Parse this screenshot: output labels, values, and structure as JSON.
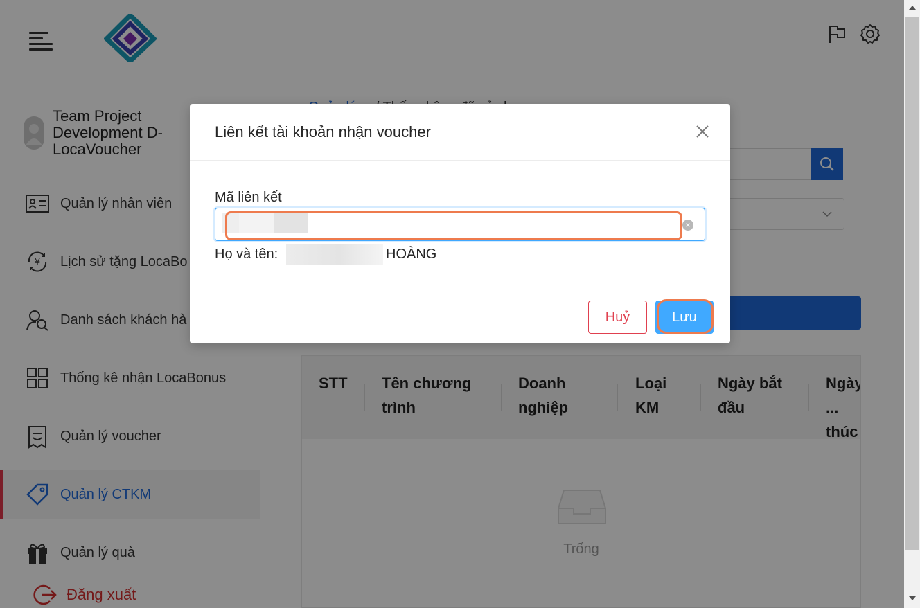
{
  "sidebar": {
    "user_name": "Team Project Development D-LocaVoucher",
    "items": [
      {
        "label": "Quản lý nhân viên",
        "icon": "id-card-icon"
      },
      {
        "label": "Lịch sử tặng LocaBo",
        "icon": "yen-cycle-icon"
      },
      {
        "label": "Danh sách khách hà",
        "icon": "user-search-icon"
      },
      {
        "label": "Thống kê nhận LocaBonus",
        "icon": "grid-icon"
      },
      {
        "label": "Quản lý voucher",
        "icon": "voucher-doc-icon"
      },
      {
        "label": "Quản lý CTKM",
        "icon": "tag-icon"
      },
      {
        "label": "Quản lý quà",
        "icon": "gift-icon"
      }
    ],
    "active_item": "Quản lý CTKM",
    "logout_label": "Đăng xuất"
  },
  "content": {
    "breadcrumb_link": "Quản lý ...",
    "breadcrumb_current": "Thống kê ... đã sử dụng",
    "table_headers": [
      "STT",
      "Tên chương trình",
      "Doanh nghiệp",
      "Loại KM",
      "Ngày bắt đầu",
      "Ngày ... thúc"
    ],
    "empty_text": "Trống"
  },
  "modal": {
    "title": "Liên kết tài khoản nhận voucher",
    "field_label": "Mã liên kết",
    "input_value": "",
    "name_label": "Họ và tên:",
    "name_value_tail": "HOÀNG",
    "cancel_label": "Huỷ",
    "save_label": "Lưu"
  },
  "colors": {
    "accent": "#1f68d8",
    "active_bar": "#e0384b",
    "save_button": "#40a9ff",
    "cancel_border": "#e0404f",
    "highlight": "#ee7b4e"
  }
}
